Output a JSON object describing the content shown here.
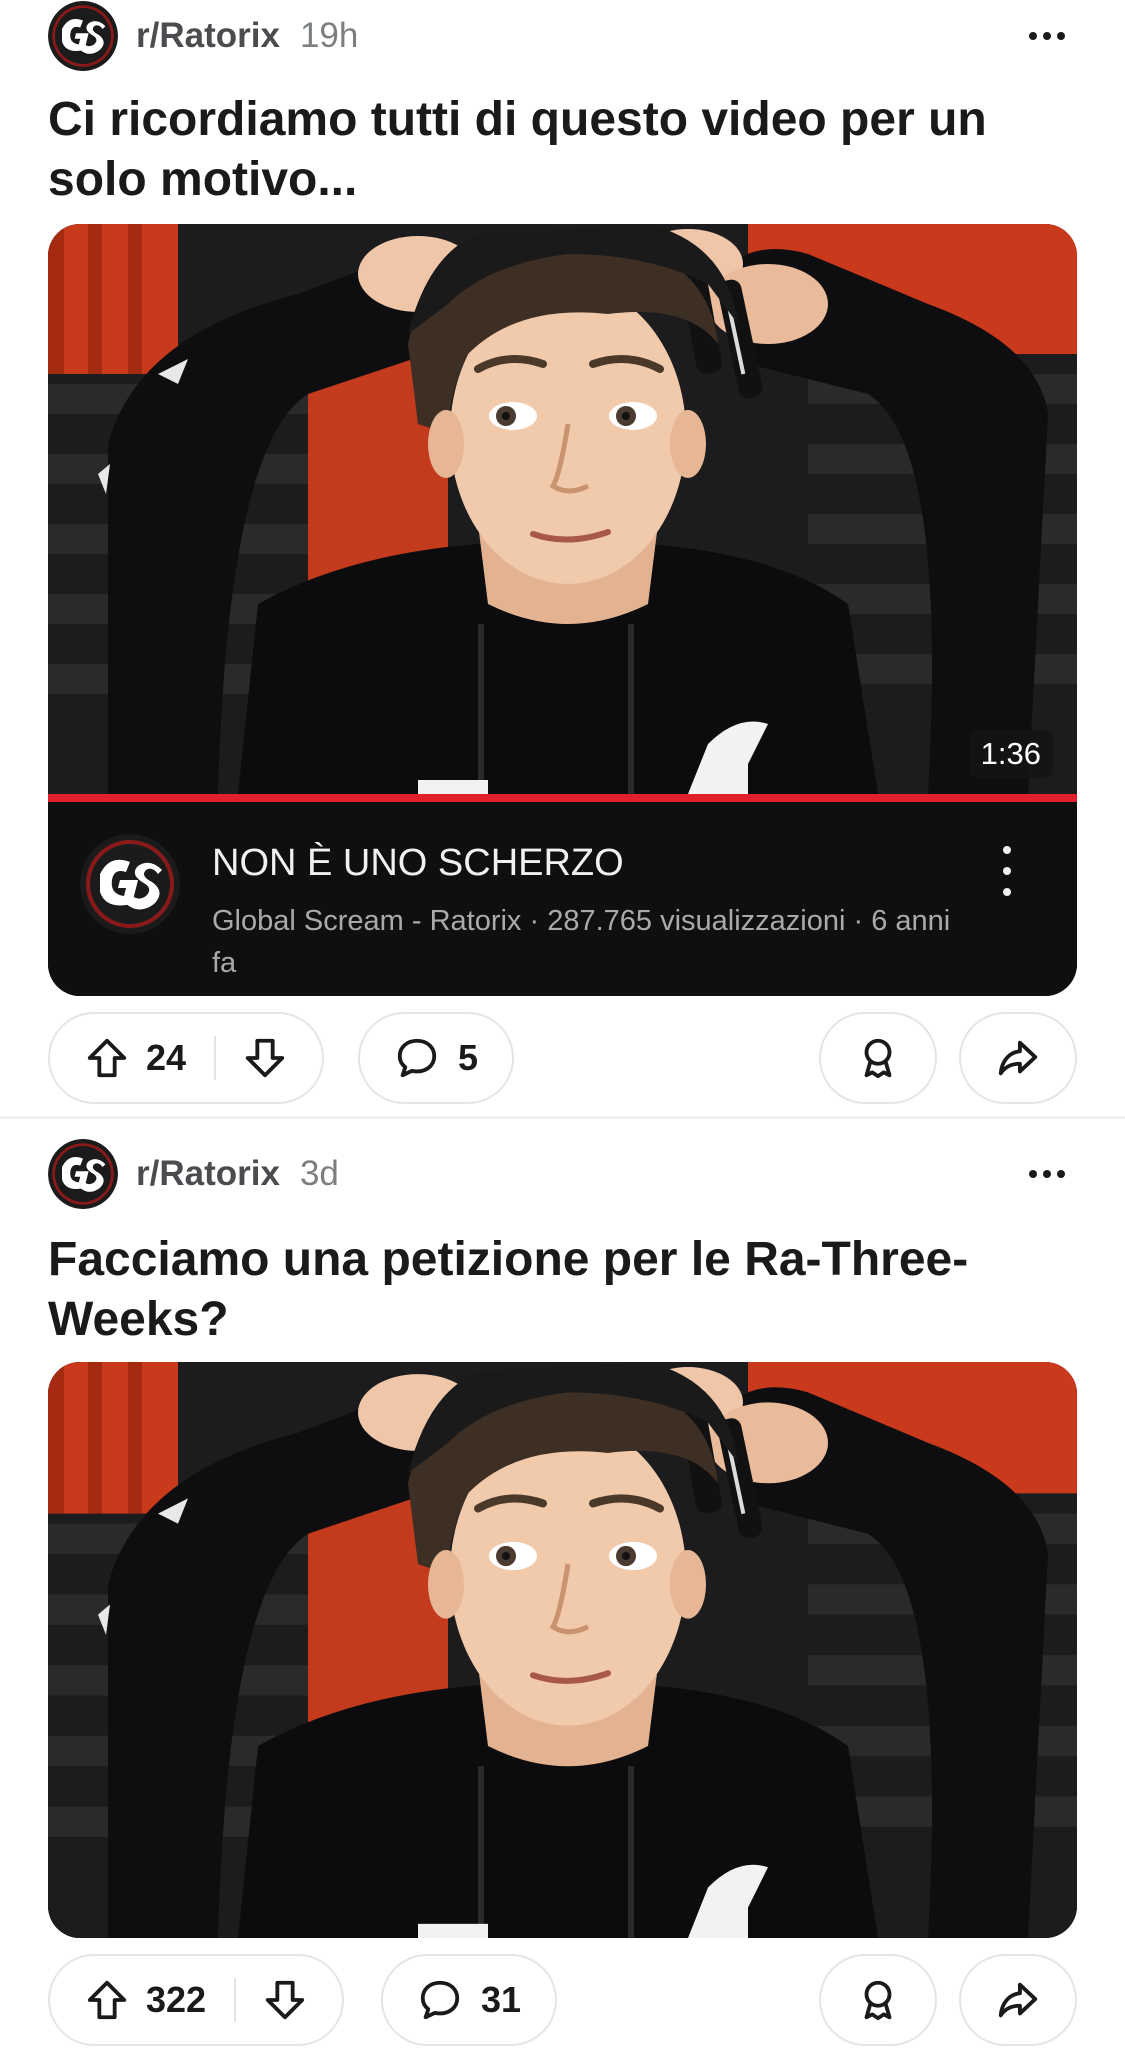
{
  "posts": [
    {
      "subreddit": "r/Ratorix",
      "age": "19h",
      "avatar_icon": "gs-logo-icon",
      "title": "Ci ricordiamo tutti di questo video per un solo motivo...",
      "media": {
        "type": "youtube-embed",
        "duration": "1:36",
        "progress_fraction": 1.0,
        "video_title": "NON È UNO SCHERZO",
        "video_meta": "Global Scream - Ratorix · 287.765 visualizzazioni · 6 anni fa"
      },
      "upvotes": "24",
      "comments": "5"
    },
    {
      "subreddit": "r/Ratorix",
      "age": "3d",
      "avatar_icon": "gs-logo-icon",
      "title": "Facciamo una petizione per le Ra-Three-Weeks?",
      "media": {
        "type": "image"
      },
      "upvotes": "322",
      "comments": "31"
    }
  ],
  "colors": {
    "accent_red": "#e0202a",
    "text_primary": "#1a1a1b",
    "text_secondary": "#7c7f82",
    "pill_border": "#e3e5e8",
    "youtube_bar": "#0f0f0f"
  },
  "icons": [
    "gs-logo-icon",
    "more-dots-icon",
    "upvote-arrow-icon",
    "downvote-arrow-icon",
    "comment-bubble-icon",
    "award-icon",
    "share-arrow-icon",
    "kebab-menu-icon"
  ]
}
